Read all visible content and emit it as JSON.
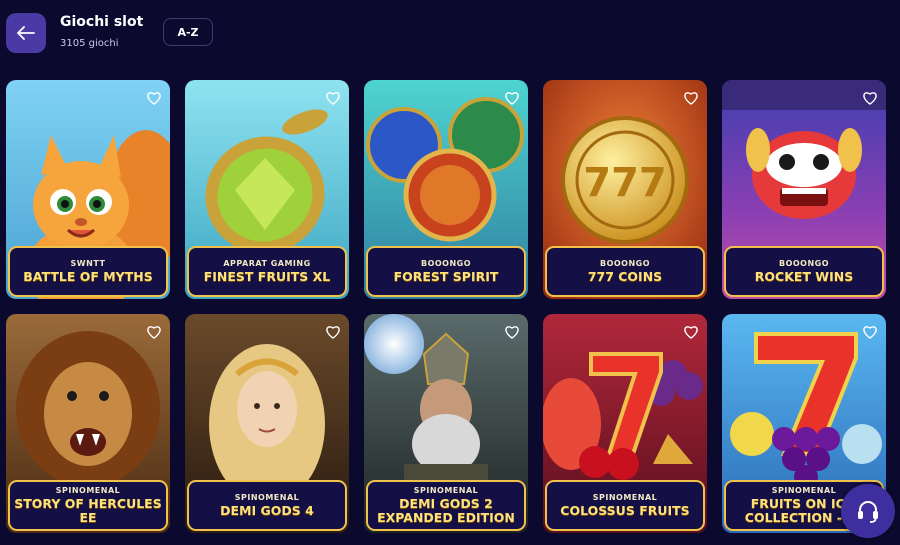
{
  "header": {
    "title": "Giochi slot",
    "count": "3105 giochi",
    "sort_label": "A-Z"
  },
  "games": [
    {
      "provider": "SWNTT",
      "name": "BATTLE OF MYTHS",
      "art": "squirrel-mascot"
    },
    {
      "provider": "APPARAT GAMING",
      "name": "FINEST FRUITS XL",
      "art": "green-gem-fruit"
    },
    {
      "provider": "BOOONGO",
      "name": "FOREST SPIRIT",
      "art": "wolf-bear-bird-coins"
    },
    {
      "provider": "BOOONGO",
      "name": "777 COINS",
      "art": "gold-777-coin"
    },
    {
      "provider": "BOOONGO",
      "name": "ROCKET WINS",
      "art": "dragon-mask"
    },
    {
      "provider": "SPINOMENAL",
      "name": "STORY OF HERCULES EE",
      "art": "lion"
    },
    {
      "provider": "SPINOMENAL",
      "name": "DEMI GODS 4",
      "art": "goddess"
    },
    {
      "provider": "SPINOMENAL",
      "name": "DEMI GODS 2 EXPANDED EDITION",
      "art": "warrior-god"
    },
    {
      "provider": "SPINOMENAL",
      "name": "COLOSSUS FRUITS",
      "art": "red-seven-fruits"
    },
    {
      "provider": "SPINOMENAL",
      "name": "FRUITS ON IC… COLLECTION -2…",
      "art": "ice-seven-grapes"
    }
  ],
  "colors": {
    "background": "#0b0a2e",
    "accent": "#4b3aa6",
    "label_border": "#f0c24c",
    "label_text": "#ffe27a"
  },
  "icons": {
    "back": "arrow-left-icon",
    "favorite": "heart-outline-icon",
    "support": "headset-icon"
  }
}
